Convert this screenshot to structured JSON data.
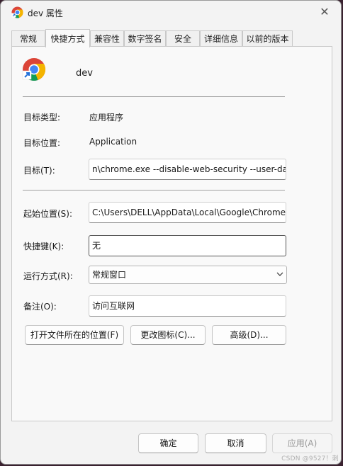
{
  "window": {
    "title": "dev 属性"
  },
  "tabs": [
    "常规",
    "快捷方式",
    "兼容性",
    "数字签名",
    "安全",
    "详细信息",
    "以前的版本"
  ],
  "active_tab": "快捷方式",
  "shortcut": {
    "name": "dev",
    "target_type_label": "目标类型:",
    "target_type_value": "应用程序",
    "target_location_label": "目标位置:",
    "target_location_value": "Application",
    "target_label": "目标(T):",
    "target_value": "n\\chrome.exe --disable-web-security --user-da",
    "start_in_label": "起始位置(S):",
    "start_in_value": "C:\\Users\\DELL\\AppData\\Local\\Google\\Chrome\\",
    "hotkey_label": "快捷键(K):",
    "hotkey_value": "无",
    "run_label": "运行方式(R):",
    "run_value": "常规窗口",
    "comment_label": "备注(O):",
    "comment_value": "访问互联网"
  },
  "buttons": {
    "open_location": "打开文件所在的位置(F)",
    "change_icon": "更改图标(C)...",
    "advanced": "高级(D)...",
    "ok": "确定",
    "cancel": "取消",
    "apply": "应用(A)"
  },
  "watermark": "CSDN @9527！刺",
  "colors": {
    "window_bg": "#f3f3f3",
    "panel_bg": "#f9f9f9",
    "desktop_bg": "#3a2230"
  }
}
